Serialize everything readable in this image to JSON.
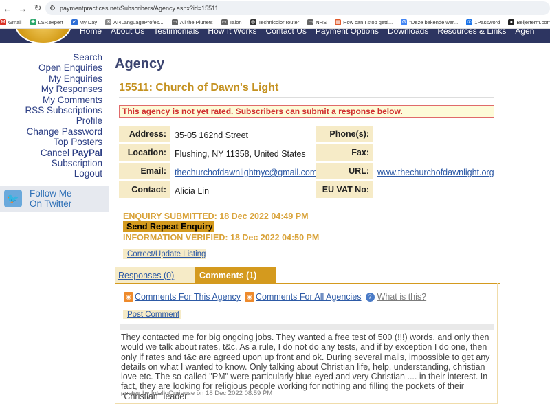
{
  "browser": {
    "url": "paymentpractices.net/Subscribers/Agency.aspx?id=15511",
    "bookmarks": [
      {
        "label": "Gmail",
        "color": "#d93025",
        "glyph": "M"
      },
      {
        "label": "LSP.expert",
        "color": "#2aa66a",
        "glyph": "✚"
      },
      {
        "label": "My Day",
        "color": "#2f6fd6",
        "glyph": "✔"
      },
      {
        "label": "AI4LanguageProfes...",
        "color": "#888",
        "glyph": "✉"
      },
      {
        "label": "All the Plunets",
        "color": "#666",
        "glyph": "▭"
      },
      {
        "label": "Talon",
        "color": "#666",
        "glyph": "▭"
      },
      {
        "label": "Technicolor router",
        "color": "#333",
        "glyph": "◎"
      },
      {
        "label": "NHS",
        "color": "#666",
        "glyph": "▭"
      },
      {
        "label": "How can I stop getti...",
        "color": "#e0592a",
        "glyph": "▦"
      },
      {
        "label": "\"Deze bekende wer...",
        "color": "#4285f4",
        "glyph": "G"
      },
      {
        "label": "1Password",
        "color": "#1a73e8",
        "glyph": "①"
      },
      {
        "label": "Beijerterm.com",
        "color": "#222",
        "glyph": "●"
      }
    ]
  },
  "site_nav": {
    "items": [
      "Home",
      "About Us",
      "Testimonials",
      "How It Works",
      "Contact Us",
      "Payment Options",
      "Downloads",
      "Resources & Links",
      "Agen"
    ]
  },
  "sidebar": {
    "links": [
      {
        "label": "Search"
      },
      {
        "label": "Open Enquiries"
      },
      {
        "label": "My Enquiries"
      },
      {
        "label": "My Responses"
      },
      {
        "label": "My Comments"
      },
      {
        "label": "RSS Subscriptions"
      },
      {
        "label": "Profile"
      },
      {
        "label": "Change Password"
      },
      {
        "label": "Top Posters"
      },
      {
        "label_prefix": "Cancel ",
        "label_bold": "PayPal"
      },
      {
        "label": "Subscription"
      },
      {
        "label": "Logout"
      }
    ],
    "twitter": {
      "line1": "Follow Me",
      "line2": "On Twitter"
    }
  },
  "page": {
    "title": "Agency",
    "agency_title": "15511: Church of Dawn's Light",
    "warning": "This agency is not yet rated. Subscribers can submit a response below."
  },
  "agency_info": {
    "address_label": "Address:",
    "address": "35-05 162nd Street",
    "location_label": "Location:",
    "location": "Flushing, NY 11358, United States",
    "email_label": "Email:",
    "email": "thechurchofdawnlightnyc@gmail.com",
    "contact_label": "Contact:",
    "contact": "Alicia Lin",
    "phone_label": "Phone(s):",
    "phone": "",
    "fax_label": "Fax:",
    "fax": "",
    "url_label": "URL:",
    "url": "www.thechurchofdawnlight.org",
    "vat_label": "EU VAT No:",
    "vat": ""
  },
  "enquiry": {
    "submitted": "ENQUIRY SUBMITTED: 18 Dec 2022 04:49 PM",
    "repeat_button": "Send Repeat Enquiry",
    "verified": "INFORMATION VERIFIED: 18 Dec 2022 04:50 PM",
    "correct_button": "Correct/Update Listing"
  },
  "tabs": {
    "responses": "Responses (0)",
    "comments": "Comments (1)"
  },
  "comments_panel": {
    "rss_agency": "Comments For This Agency",
    "rss_all": "Comments For All Agencies",
    "what_is_this": "What is this?",
    "post_button": "Post Comment",
    "comment_text": "They contacted me for big ongoing jobs. They wanted a free test of 500 (!!!) words, and only then would we talk about rates, t&c. As a rule, I do not do any tests, and if by exception I do one, then only if rates and t&c are agreed upon up front and ok. During several mails, impossible to get any details on what I wanted to know. Only talking about Christian life, help, understanding, christian love etc. The so-called \"PM\" were particularly blue-eyed and very Christian .... in their interest. In fact, they are looking for religious people working for nothing and filling the pockets of their \"Christian\" leader.",
    "comment_meta": "posted by IntelloCurieuse on 18 Dec 2022 08:59 PM"
  },
  "colors": {
    "nav_bg": "#2d3561",
    "gold": "#d49a1e",
    "label_bg": "#f6ebc7",
    "link": "#2d5aa6",
    "warning_text": "#d03030"
  }
}
